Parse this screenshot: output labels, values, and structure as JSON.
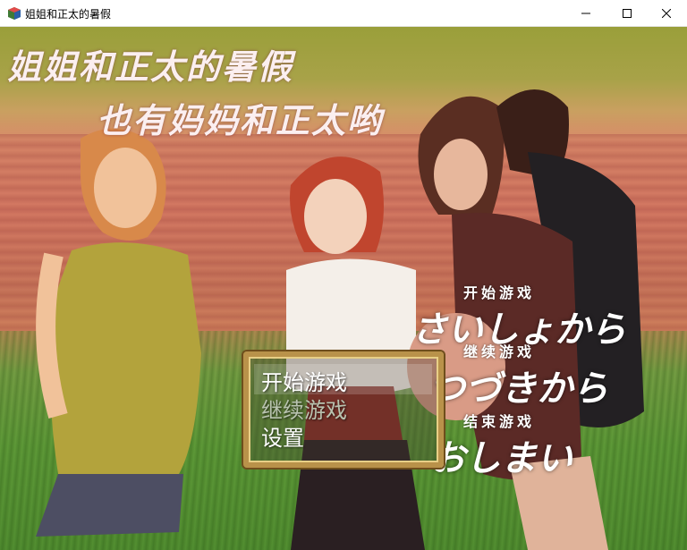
{
  "window": {
    "title": "姐姐和正太的暑假"
  },
  "game": {
    "heading_line1": "姐姐和正太的暑假",
    "heading_line2": "也有妈妈和正太哟",
    "menu": {
      "items": [
        "开始游戏",
        "继续游戏",
        "设置"
      ],
      "selected_index": 0,
      "disabled_index": 1
    },
    "logo": {
      "start_small": "开始游戏",
      "start_big": "さいしょから",
      "continue_small": "继续游戏",
      "continue_big": "つづきから",
      "end_small": "结束游戏",
      "end_big": "おしまい"
    }
  },
  "colors": {
    "menu_frame": "#b9924a",
    "menu_text": "#ffffff",
    "menu_text_disabled": "#b9c3b0",
    "heading": "#fbeff0"
  }
}
